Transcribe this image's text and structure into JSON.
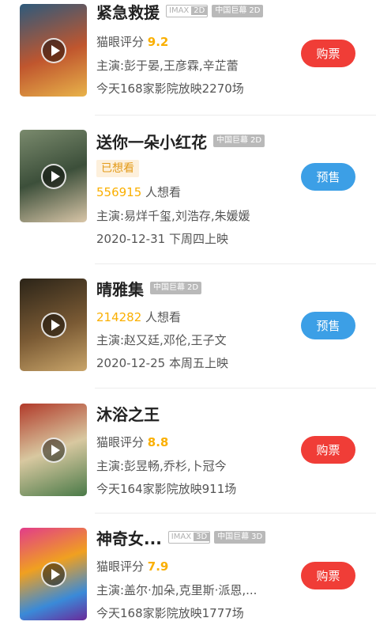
{
  "movies": [
    {
      "title": "紧急救援",
      "badges": {
        "imax_left": "IMAX",
        "imax_right": "2D",
        "screen_left": "中国巨幕",
        "screen_right": "2D"
      },
      "rating_label": "猫眼评分",
      "rating": "9.2",
      "cast": "主演:彭于晏,王彦霖,辛芷蕾",
      "schedule": "今天168家影院放映2270场",
      "button": "购票",
      "poster_icon": "play-icon"
    },
    {
      "title": "送你一朵小红花",
      "badges": {
        "screen_left": "中国巨幕",
        "screen_right": "2D"
      },
      "wanted_tag": "已想看",
      "want_count": "556915",
      "want_label": " 人想看",
      "cast": "主演:易烊千玺,刘浩存,朱媛媛",
      "release": "2020-12-31 下周四上映",
      "button": "预售",
      "poster_icon": "play-icon"
    },
    {
      "title": "晴雅集",
      "badges": {
        "screen_left": "中国巨幕",
        "screen_right": "2D"
      },
      "want_count": "214282",
      "want_label": " 人想看",
      "cast": "主演:赵又廷,邓伦,王子文",
      "release": "2020-12-25 本周五上映",
      "button": "预售",
      "poster_icon": "play-icon"
    },
    {
      "title": "沐浴之王",
      "rating_label": "猫眼评分",
      "rating": "8.8",
      "cast": "主演:彭昱畅,乔杉,卜冠今",
      "schedule": "今天164家影院放映911场",
      "button": "购票",
      "poster_icon": "play-icon"
    },
    {
      "title": "神奇女...",
      "badges": {
        "imax_left": "IMAX",
        "imax_right": "3D",
        "screen_left": "中国巨幕",
        "screen_right": "3D"
      },
      "rating_label": "猫眼评分",
      "rating": "7.9",
      "cast": "主演:盖尔·加朵,克里斯·派恩,...",
      "schedule": "今天168家影院放映1777场",
      "button": "购票",
      "poster_icon": "play-icon"
    }
  ],
  "colors": {
    "buy": "#f03d37",
    "presale": "#3c9fe6",
    "score": "#faaf00"
  }
}
